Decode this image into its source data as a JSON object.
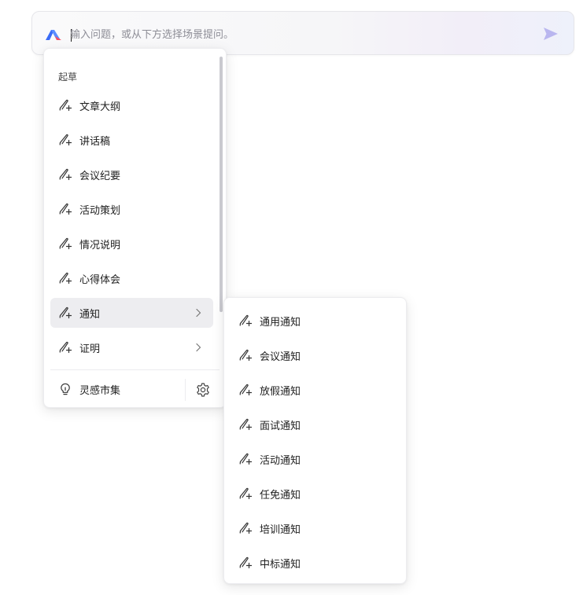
{
  "prompt": {
    "placeholder": "输入问题，或从下方选择场景提问。",
    "logo_icon": "app-logo-icon",
    "send_icon": "send-icon"
  },
  "scenes": {
    "group_title": "起草",
    "items": [
      {
        "label": "文章大纲"
      },
      {
        "label": "讲话稿"
      },
      {
        "label": "会议纪要"
      },
      {
        "label": "活动策划"
      },
      {
        "label": "情况说明"
      },
      {
        "label": "心得体会"
      },
      {
        "label": "通知"
      },
      {
        "label": "证明"
      }
    ],
    "footer": {
      "market_label": "灵感市集",
      "market_icon": "lightbulb-icon",
      "settings_icon": "gear-icon"
    }
  },
  "submenu": {
    "items": [
      {
        "label": "通用通知"
      },
      {
        "label": "会议通知"
      },
      {
        "label": "放假通知"
      },
      {
        "label": "面试通知"
      },
      {
        "label": "活动通知"
      },
      {
        "label": "任免通知"
      },
      {
        "label": "培训通知"
      },
      {
        "label": "中标通知"
      }
    ]
  },
  "colors": {
    "logo_blue": "#3b6cf6",
    "logo_red": "#ff4d5e",
    "send_icon": "#b9b6ef",
    "active_item_bg": "#ededf0"
  }
}
